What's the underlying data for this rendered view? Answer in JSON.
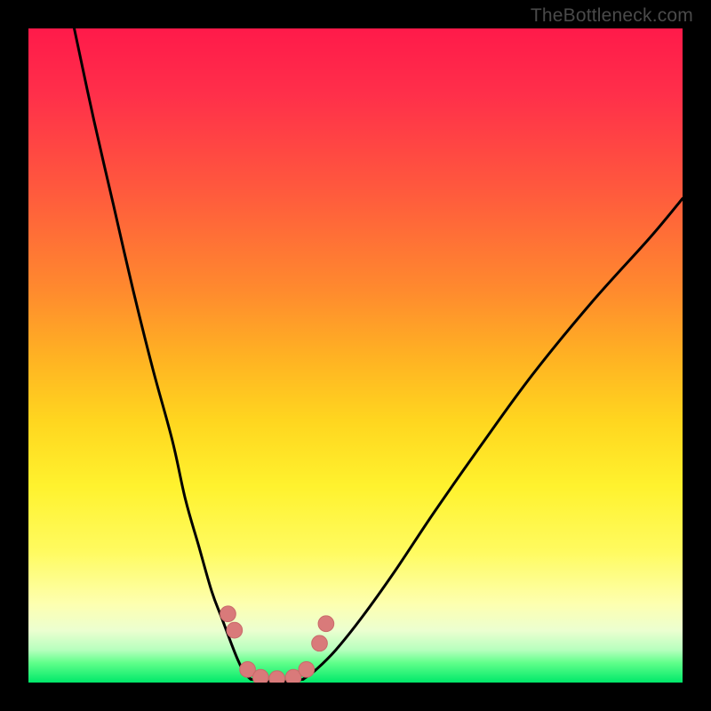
{
  "watermark": "TheBottleneck.com",
  "colors": {
    "background": "#000000",
    "curve": "#000000",
    "marker_fill": "#d97a7a",
    "marker_stroke": "#c96a6a"
  },
  "chart_data": {
    "type": "line",
    "title": "",
    "xlabel": "",
    "ylabel": "",
    "xlim": [
      0,
      100
    ],
    "ylim": [
      0,
      100
    ],
    "grid": false,
    "legend": false,
    "series": [
      {
        "name": "left-curve",
        "x": [
          7,
          10,
          13,
          16,
          19,
          22,
          24,
          26,
          28,
          29.5,
          31,
          32,
          33,
          34
        ],
        "y": [
          100,
          86,
          73,
          60,
          48,
          37,
          28,
          21,
          14,
          10,
          6,
          3.5,
          1.5,
          0.5
        ]
      },
      {
        "name": "right-curve",
        "x": [
          42,
          44,
          47,
          51,
          56,
          62,
          69,
          77,
          86,
          95,
          100
        ],
        "y": [
          0.5,
          2,
          5,
          10,
          17,
          26,
          36,
          47,
          58,
          68,
          74
        ]
      },
      {
        "name": "valley-floor",
        "x": [
          34,
          36,
          38,
          40,
          42
        ],
        "y": [
          0.5,
          0.2,
          0.2,
          0.2,
          0.5
        ]
      }
    ],
    "markers": {
      "name": "highlighted-points",
      "points": [
        {
          "x": 30.5,
          "y": 10.5
        },
        {
          "x": 31.5,
          "y": 8
        },
        {
          "x": 33.5,
          "y": 2
        },
        {
          "x": 35.5,
          "y": 0.8
        },
        {
          "x": 38,
          "y": 0.6
        },
        {
          "x": 40.5,
          "y": 0.8
        },
        {
          "x": 42.5,
          "y": 2
        },
        {
          "x": 44.5,
          "y": 6
        },
        {
          "x": 45.5,
          "y": 9
        }
      ],
      "radius_data_units": 1.2
    }
  }
}
